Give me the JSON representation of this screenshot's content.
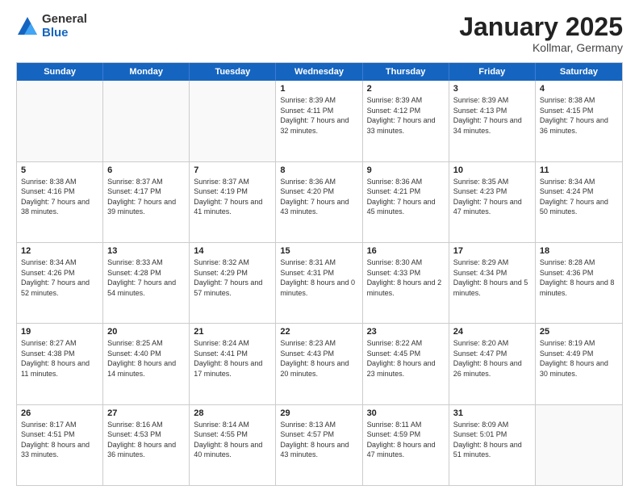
{
  "logo": {
    "general": "General",
    "blue": "Blue"
  },
  "header": {
    "month": "January 2025",
    "location": "Kollmar, Germany"
  },
  "weekdays": [
    "Sunday",
    "Monday",
    "Tuesday",
    "Wednesday",
    "Thursday",
    "Friday",
    "Saturday"
  ],
  "weeks": [
    [
      {
        "day": "",
        "sunrise": "",
        "sunset": "",
        "daylight": ""
      },
      {
        "day": "",
        "sunrise": "",
        "sunset": "",
        "daylight": ""
      },
      {
        "day": "",
        "sunrise": "",
        "sunset": "",
        "daylight": ""
      },
      {
        "day": "1",
        "sunrise": "Sunrise: 8:39 AM",
        "sunset": "Sunset: 4:11 PM",
        "daylight": "Daylight: 7 hours and 32 minutes."
      },
      {
        "day": "2",
        "sunrise": "Sunrise: 8:39 AM",
        "sunset": "Sunset: 4:12 PM",
        "daylight": "Daylight: 7 hours and 33 minutes."
      },
      {
        "day": "3",
        "sunrise": "Sunrise: 8:39 AM",
        "sunset": "Sunset: 4:13 PM",
        "daylight": "Daylight: 7 hours and 34 minutes."
      },
      {
        "day": "4",
        "sunrise": "Sunrise: 8:38 AM",
        "sunset": "Sunset: 4:15 PM",
        "daylight": "Daylight: 7 hours and 36 minutes."
      }
    ],
    [
      {
        "day": "5",
        "sunrise": "Sunrise: 8:38 AM",
        "sunset": "Sunset: 4:16 PM",
        "daylight": "Daylight: 7 hours and 38 minutes."
      },
      {
        "day": "6",
        "sunrise": "Sunrise: 8:37 AM",
        "sunset": "Sunset: 4:17 PM",
        "daylight": "Daylight: 7 hours and 39 minutes."
      },
      {
        "day": "7",
        "sunrise": "Sunrise: 8:37 AM",
        "sunset": "Sunset: 4:19 PM",
        "daylight": "Daylight: 7 hours and 41 minutes."
      },
      {
        "day": "8",
        "sunrise": "Sunrise: 8:36 AM",
        "sunset": "Sunset: 4:20 PM",
        "daylight": "Daylight: 7 hours and 43 minutes."
      },
      {
        "day": "9",
        "sunrise": "Sunrise: 8:36 AM",
        "sunset": "Sunset: 4:21 PM",
        "daylight": "Daylight: 7 hours and 45 minutes."
      },
      {
        "day": "10",
        "sunrise": "Sunrise: 8:35 AM",
        "sunset": "Sunset: 4:23 PM",
        "daylight": "Daylight: 7 hours and 47 minutes."
      },
      {
        "day": "11",
        "sunrise": "Sunrise: 8:34 AM",
        "sunset": "Sunset: 4:24 PM",
        "daylight": "Daylight: 7 hours and 50 minutes."
      }
    ],
    [
      {
        "day": "12",
        "sunrise": "Sunrise: 8:34 AM",
        "sunset": "Sunset: 4:26 PM",
        "daylight": "Daylight: 7 hours and 52 minutes."
      },
      {
        "day": "13",
        "sunrise": "Sunrise: 8:33 AM",
        "sunset": "Sunset: 4:28 PM",
        "daylight": "Daylight: 7 hours and 54 minutes."
      },
      {
        "day": "14",
        "sunrise": "Sunrise: 8:32 AM",
        "sunset": "Sunset: 4:29 PM",
        "daylight": "Daylight: 7 hours and 57 minutes."
      },
      {
        "day": "15",
        "sunrise": "Sunrise: 8:31 AM",
        "sunset": "Sunset: 4:31 PM",
        "daylight": "Daylight: 8 hours and 0 minutes."
      },
      {
        "day": "16",
        "sunrise": "Sunrise: 8:30 AM",
        "sunset": "Sunset: 4:33 PM",
        "daylight": "Daylight: 8 hours and 2 minutes."
      },
      {
        "day": "17",
        "sunrise": "Sunrise: 8:29 AM",
        "sunset": "Sunset: 4:34 PM",
        "daylight": "Daylight: 8 hours and 5 minutes."
      },
      {
        "day": "18",
        "sunrise": "Sunrise: 8:28 AM",
        "sunset": "Sunset: 4:36 PM",
        "daylight": "Daylight: 8 hours and 8 minutes."
      }
    ],
    [
      {
        "day": "19",
        "sunrise": "Sunrise: 8:27 AM",
        "sunset": "Sunset: 4:38 PM",
        "daylight": "Daylight: 8 hours and 11 minutes."
      },
      {
        "day": "20",
        "sunrise": "Sunrise: 8:25 AM",
        "sunset": "Sunset: 4:40 PM",
        "daylight": "Daylight: 8 hours and 14 minutes."
      },
      {
        "day": "21",
        "sunrise": "Sunrise: 8:24 AM",
        "sunset": "Sunset: 4:41 PM",
        "daylight": "Daylight: 8 hours and 17 minutes."
      },
      {
        "day": "22",
        "sunrise": "Sunrise: 8:23 AM",
        "sunset": "Sunset: 4:43 PM",
        "daylight": "Daylight: 8 hours and 20 minutes."
      },
      {
        "day": "23",
        "sunrise": "Sunrise: 8:22 AM",
        "sunset": "Sunset: 4:45 PM",
        "daylight": "Daylight: 8 hours and 23 minutes."
      },
      {
        "day": "24",
        "sunrise": "Sunrise: 8:20 AM",
        "sunset": "Sunset: 4:47 PM",
        "daylight": "Daylight: 8 hours and 26 minutes."
      },
      {
        "day": "25",
        "sunrise": "Sunrise: 8:19 AM",
        "sunset": "Sunset: 4:49 PM",
        "daylight": "Daylight: 8 hours and 30 minutes."
      }
    ],
    [
      {
        "day": "26",
        "sunrise": "Sunrise: 8:17 AM",
        "sunset": "Sunset: 4:51 PM",
        "daylight": "Daylight: 8 hours and 33 minutes."
      },
      {
        "day": "27",
        "sunrise": "Sunrise: 8:16 AM",
        "sunset": "Sunset: 4:53 PM",
        "daylight": "Daylight: 8 hours and 36 minutes."
      },
      {
        "day": "28",
        "sunrise": "Sunrise: 8:14 AM",
        "sunset": "Sunset: 4:55 PM",
        "daylight": "Daylight: 8 hours and 40 minutes."
      },
      {
        "day": "29",
        "sunrise": "Sunrise: 8:13 AM",
        "sunset": "Sunset: 4:57 PM",
        "daylight": "Daylight: 8 hours and 43 minutes."
      },
      {
        "day": "30",
        "sunrise": "Sunrise: 8:11 AM",
        "sunset": "Sunset: 4:59 PM",
        "daylight": "Daylight: 8 hours and 47 minutes."
      },
      {
        "day": "31",
        "sunrise": "Sunrise: 8:09 AM",
        "sunset": "Sunset: 5:01 PM",
        "daylight": "Daylight: 8 hours and 51 minutes."
      },
      {
        "day": "",
        "sunrise": "",
        "sunset": "",
        "daylight": ""
      }
    ]
  ]
}
